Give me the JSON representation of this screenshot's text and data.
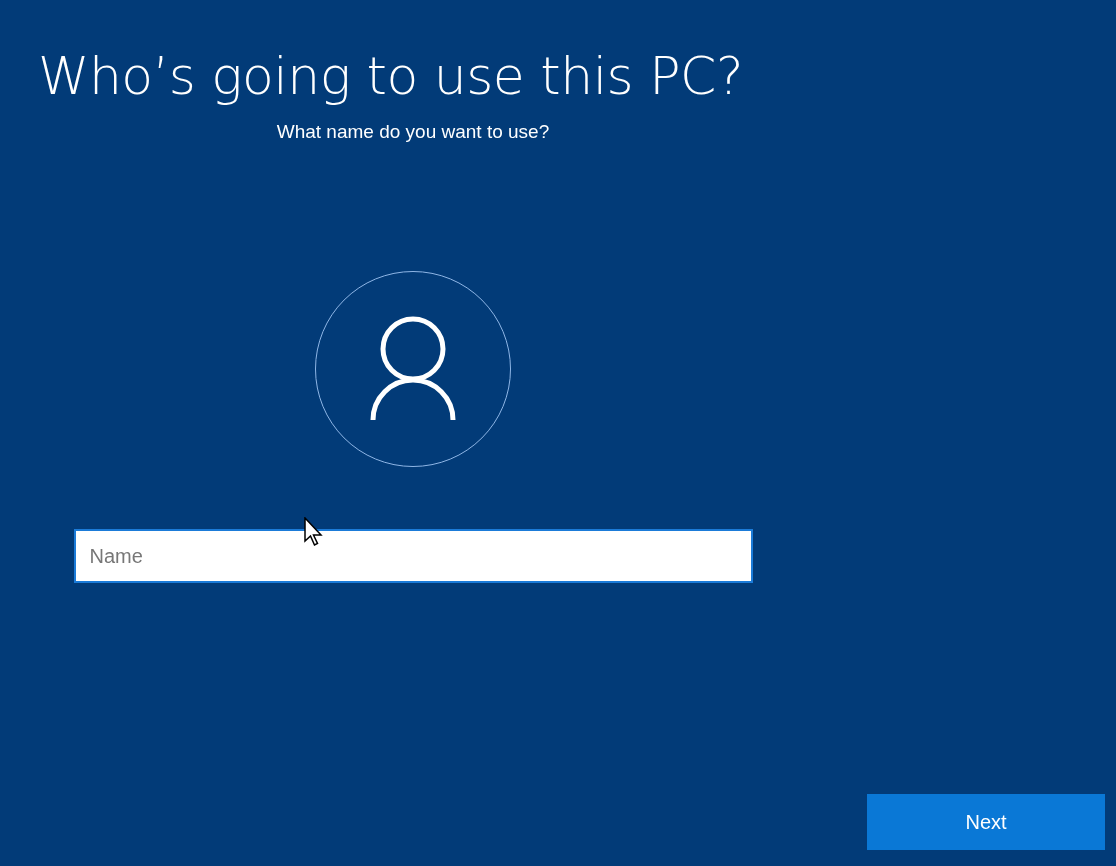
{
  "title": "Who’s going to use this PC?",
  "subtitle": "What name do you want to use?",
  "name_field": {
    "placeholder": "Name"
  },
  "buttons": [
    {
      "label": "Next",
      "kind": "primary"
    }
  ]
}
